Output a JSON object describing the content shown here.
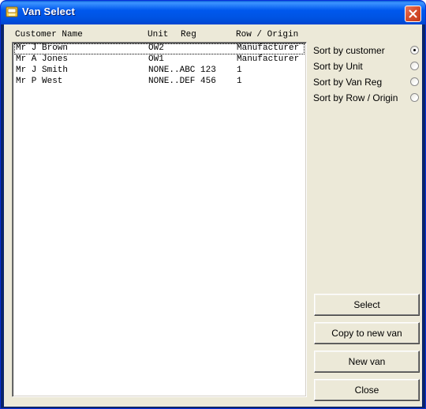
{
  "window": {
    "title": "Van Select",
    "close_label": "×"
  },
  "table": {
    "headers": {
      "customer": "Customer Name",
      "unit": "Unit",
      "reg": "Reg",
      "origin": "Row / Origin"
    },
    "rows": [
      {
        "customer": "Mr J Brown",
        "unit_reg": "OW2",
        "origin": "Manufacturer",
        "focused": true
      },
      {
        "customer": "Mr A Jones",
        "unit_reg": "OW1",
        "origin": "Manufacturer",
        "focused": false
      },
      {
        "customer": "Mr J Smith",
        "unit_reg": "NONE..ABC 123",
        "origin": "1",
        "focused": false
      },
      {
        "customer": "Mr P West",
        "unit_reg": "NONE..DEF 456",
        "origin": "1",
        "focused": false
      }
    ]
  },
  "sort_options": [
    {
      "label": "Sort by customer",
      "selected": true
    },
    {
      "label": "Sort by Unit",
      "selected": false
    },
    {
      "label": "Sort by Van Reg",
      "selected": false
    },
    {
      "label": "Sort by Row / Origin",
      "selected": false
    }
  ],
  "buttons": {
    "select": "Select",
    "copy_to_new_van": "Copy to new van",
    "new_van": "New van",
    "close": "Close"
  },
  "colors": {
    "titlebar": "#0054e3",
    "dialog_face": "#ece9d8",
    "close_button": "#d8502e"
  },
  "icons": {
    "app": "folder-icon",
    "close": "close-icon"
  }
}
